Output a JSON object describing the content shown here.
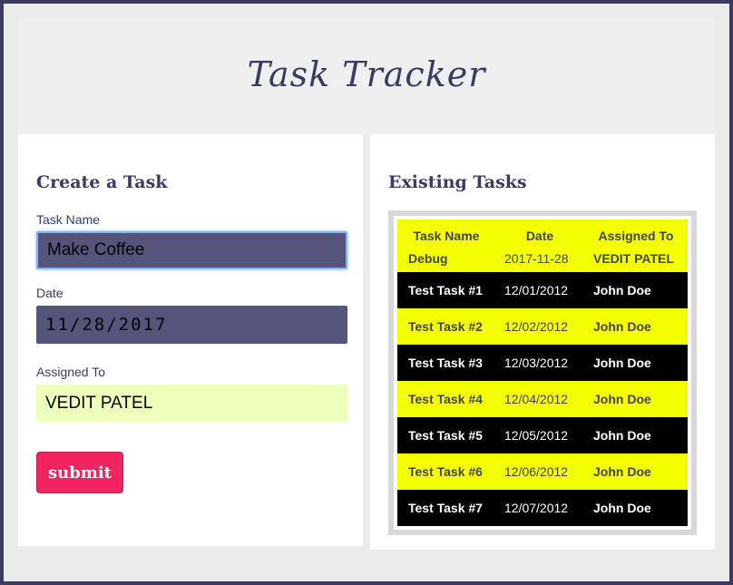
{
  "app": {
    "title": "Task Tracker"
  },
  "form": {
    "heading": "Create a Task",
    "task_name_label": "Task Name",
    "task_name_value": "Make Coffee",
    "date_label": "Date",
    "date_value": "11/28/2017",
    "assigned_label": "Assigned To",
    "assigned_value": "VEDIT PATEL",
    "submit_label": "submit"
  },
  "tasks": {
    "heading": "Existing Tasks",
    "columns": [
      "Task Name",
      "Date",
      "Assigned To"
    ],
    "rows": [
      {
        "name": "Debug",
        "date": "2017-11-28",
        "assigned": "VEDIT PATEL"
      },
      {
        "name": "Test Task #1",
        "date": "12/01/2012",
        "assigned": "John Doe"
      },
      {
        "name": "Test Task #2",
        "date": "12/02/2012",
        "assigned": "John Doe"
      },
      {
        "name": "Test Task #3",
        "date": "12/03/2012",
        "assigned": "John Doe"
      },
      {
        "name": "Test Task #4",
        "date": "12/04/2012",
        "assigned": "John Doe"
      },
      {
        "name": "Test Task #5",
        "date": "12/05/2012",
        "assigned": "John Doe"
      },
      {
        "name": "Test Task #6",
        "date": "12/06/2012",
        "assigned": "John Doe"
      },
      {
        "name": "Test Task #7",
        "date": "12/07/2012",
        "assigned": "John Doe"
      }
    ]
  },
  "colors": {
    "brand": "#3b3a64",
    "accent": "#f2245f",
    "row_yellow": "#f3ff00",
    "row_black": "#000000",
    "focus_ring": "#7fb6f7"
  }
}
